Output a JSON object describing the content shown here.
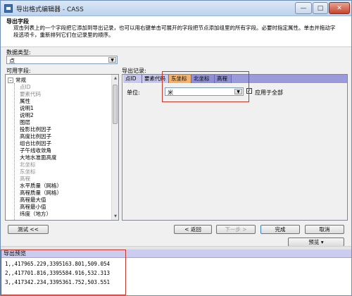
{
  "window": {
    "title": "导出格式编辑器 - CASS"
  },
  "header": {
    "title": "导出字段",
    "description": "双击列表上的一个字段把它添加到导出记录，也可以用右键单击可展开的字段把节点添加组里的所有字段。必要时指定属性。单击并拖动字段选项卡，重新排列它们在记录里的顺序。"
  },
  "data_type": {
    "label": "数据类型:",
    "value": "点"
  },
  "available_fields": {
    "label": "可用字段:",
    "root": "常规",
    "items": [
      "点ID",
      "要素代码",
      "属性",
      "说明1",
      "说明2",
      "图层",
      "投影比例因子",
      "高度比例因子",
      "组合比例因子",
      "子午线收敛角",
      "大地水准面高度",
      "北坐标",
      "东坐标",
      "高程",
      "水平质量（网格）",
      "高程质量（网格）",
      "高程最大值",
      "高程最小值",
      "纬度（地方）"
    ]
  },
  "export_record": {
    "label": "导出记录:",
    "tabs": [
      "点ID",
      "要素代码",
      "东坐标",
      "北坐标",
      "高程"
    ],
    "active_tab": "东坐标",
    "unit_label": "单位:",
    "unit_value": "米",
    "apply_all_label": "应用于全部"
  },
  "buttons": {
    "test": "测试 <<",
    "back": "< 返回",
    "next": "下一步 >",
    "finish": "完成",
    "cancel": "取消",
    "preview": "预览"
  },
  "preview": {
    "title": "导出预览",
    "lines": [
      "1,,417965.229,3395163.801,509.054",
      "2,,417701.816,3395584.916,532.313",
      "3,,417342.234,3395361.752,503.551"
    ]
  }
}
